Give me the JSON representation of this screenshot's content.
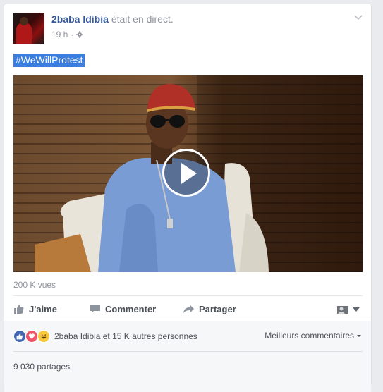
{
  "post": {
    "author": "2baba Idibia",
    "action": "était en direct.",
    "time": "19 h",
    "separator": "·",
    "privacy_icon": "gear-icon",
    "hashtag": "#WeWillProtest",
    "video": {
      "play_icon": "play-icon"
    },
    "views": "200 K vues"
  },
  "actions": {
    "like": "J'aime",
    "comment": "Commenter",
    "share": "Partager"
  },
  "footer": {
    "reactions_text": "2baba Idibia et 15 K autres personnes",
    "reaction_icons": [
      "like-reaction-icon",
      "love-reaction-icon",
      "haha-reaction-icon"
    ],
    "sort_label": "Meilleurs commentaires",
    "shares": "9 030 partages"
  },
  "colors": {
    "link": "#365899",
    "hashtag_highlight": "#3a7ee0",
    "like_blue": "#4267b2",
    "love_red": "#f25268",
    "haha_yellow": "#f7c83b"
  }
}
